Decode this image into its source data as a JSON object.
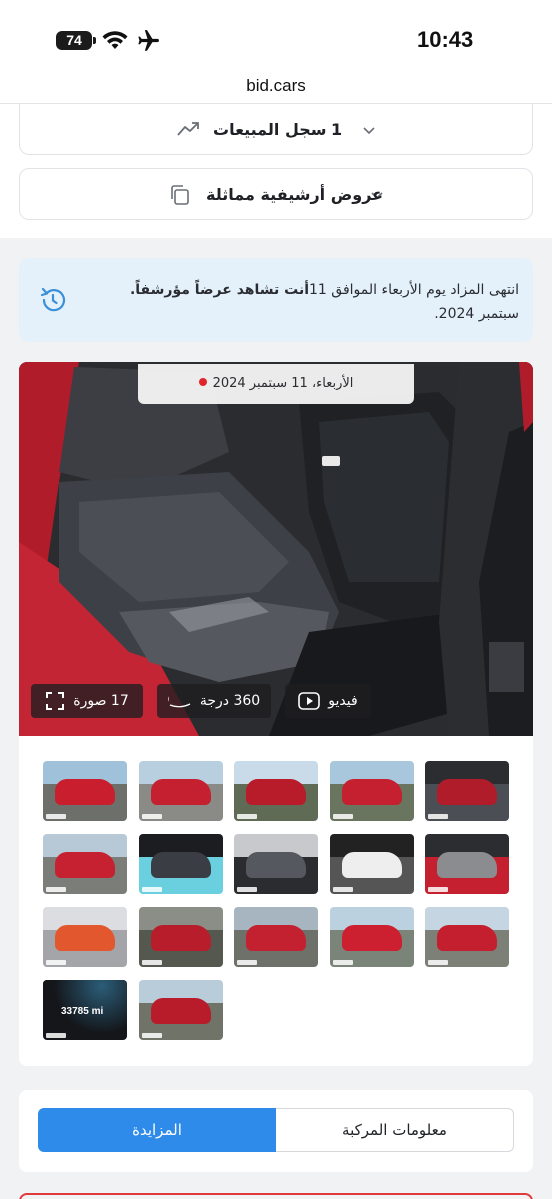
{
  "status_bar": {
    "battery": "74",
    "time": "10:43"
  },
  "browser": {
    "url": "bid.cars"
  },
  "sales_history": {
    "title": "سجل المبيعات",
    "count": "1"
  },
  "similar_archived": {
    "title": "عروض أرشيفية مماثلة"
  },
  "notice": {
    "prefix": "انتهى المزاد يوم الأربعاء الموافق 11",
    "bold": "أنت تشاهد عرضاً مؤرشفاً.",
    "suffix": "سبتمبر 2024."
  },
  "photo": {
    "date_label": "الأربعاء، 11 سبتمبر 2024",
    "photos_button": "17 صورة",
    "degree_button": "360 درجة",
    "video_button": "فيديو"
  },
  "thumbnails": [
    {
      "scene": "red-car-front"
    },
    {
      "scene": "red-car-damaged-front"
    },
    {
      "scene": "red-car-rear"
    },
    {
      "scene": "red-car-side"
    },
    {
      "scene": "interior-rear-seat"
    },
    {
      "scene": "front-crash"
    },
    {
      "scene": "dashboard"
    },
    {
      "scene": "rear-seat"
    },
    {
      "scene": "label-sticker"
    },
    {
      "scene": "engine-bay"
    },
    {
      "scene": "key-fob"
    },
    {
      "scene": "bumper-parts"
    },
    {
      "scene": "front-bumper-damage"
    },
    {
      "scene": "side-profile"
    },
    {
      "scene": "side-rear"
    },
    {
      "scene": "odometer"
    },
    {
      "scene": "rear-view"
    }
  ],
  "odometer_text": "33785 mi",
  "tabs": {
    "auction": "المزايدة",
    "vehicle_info": "معلومات المركبة"
  },
  "colors": {
    "accent": "#2f8bea",
    "notice_bg": "#e4f1fb",
    "live_dot": "#e0262b",
    "car_red": "#c2182a"
  }
}
